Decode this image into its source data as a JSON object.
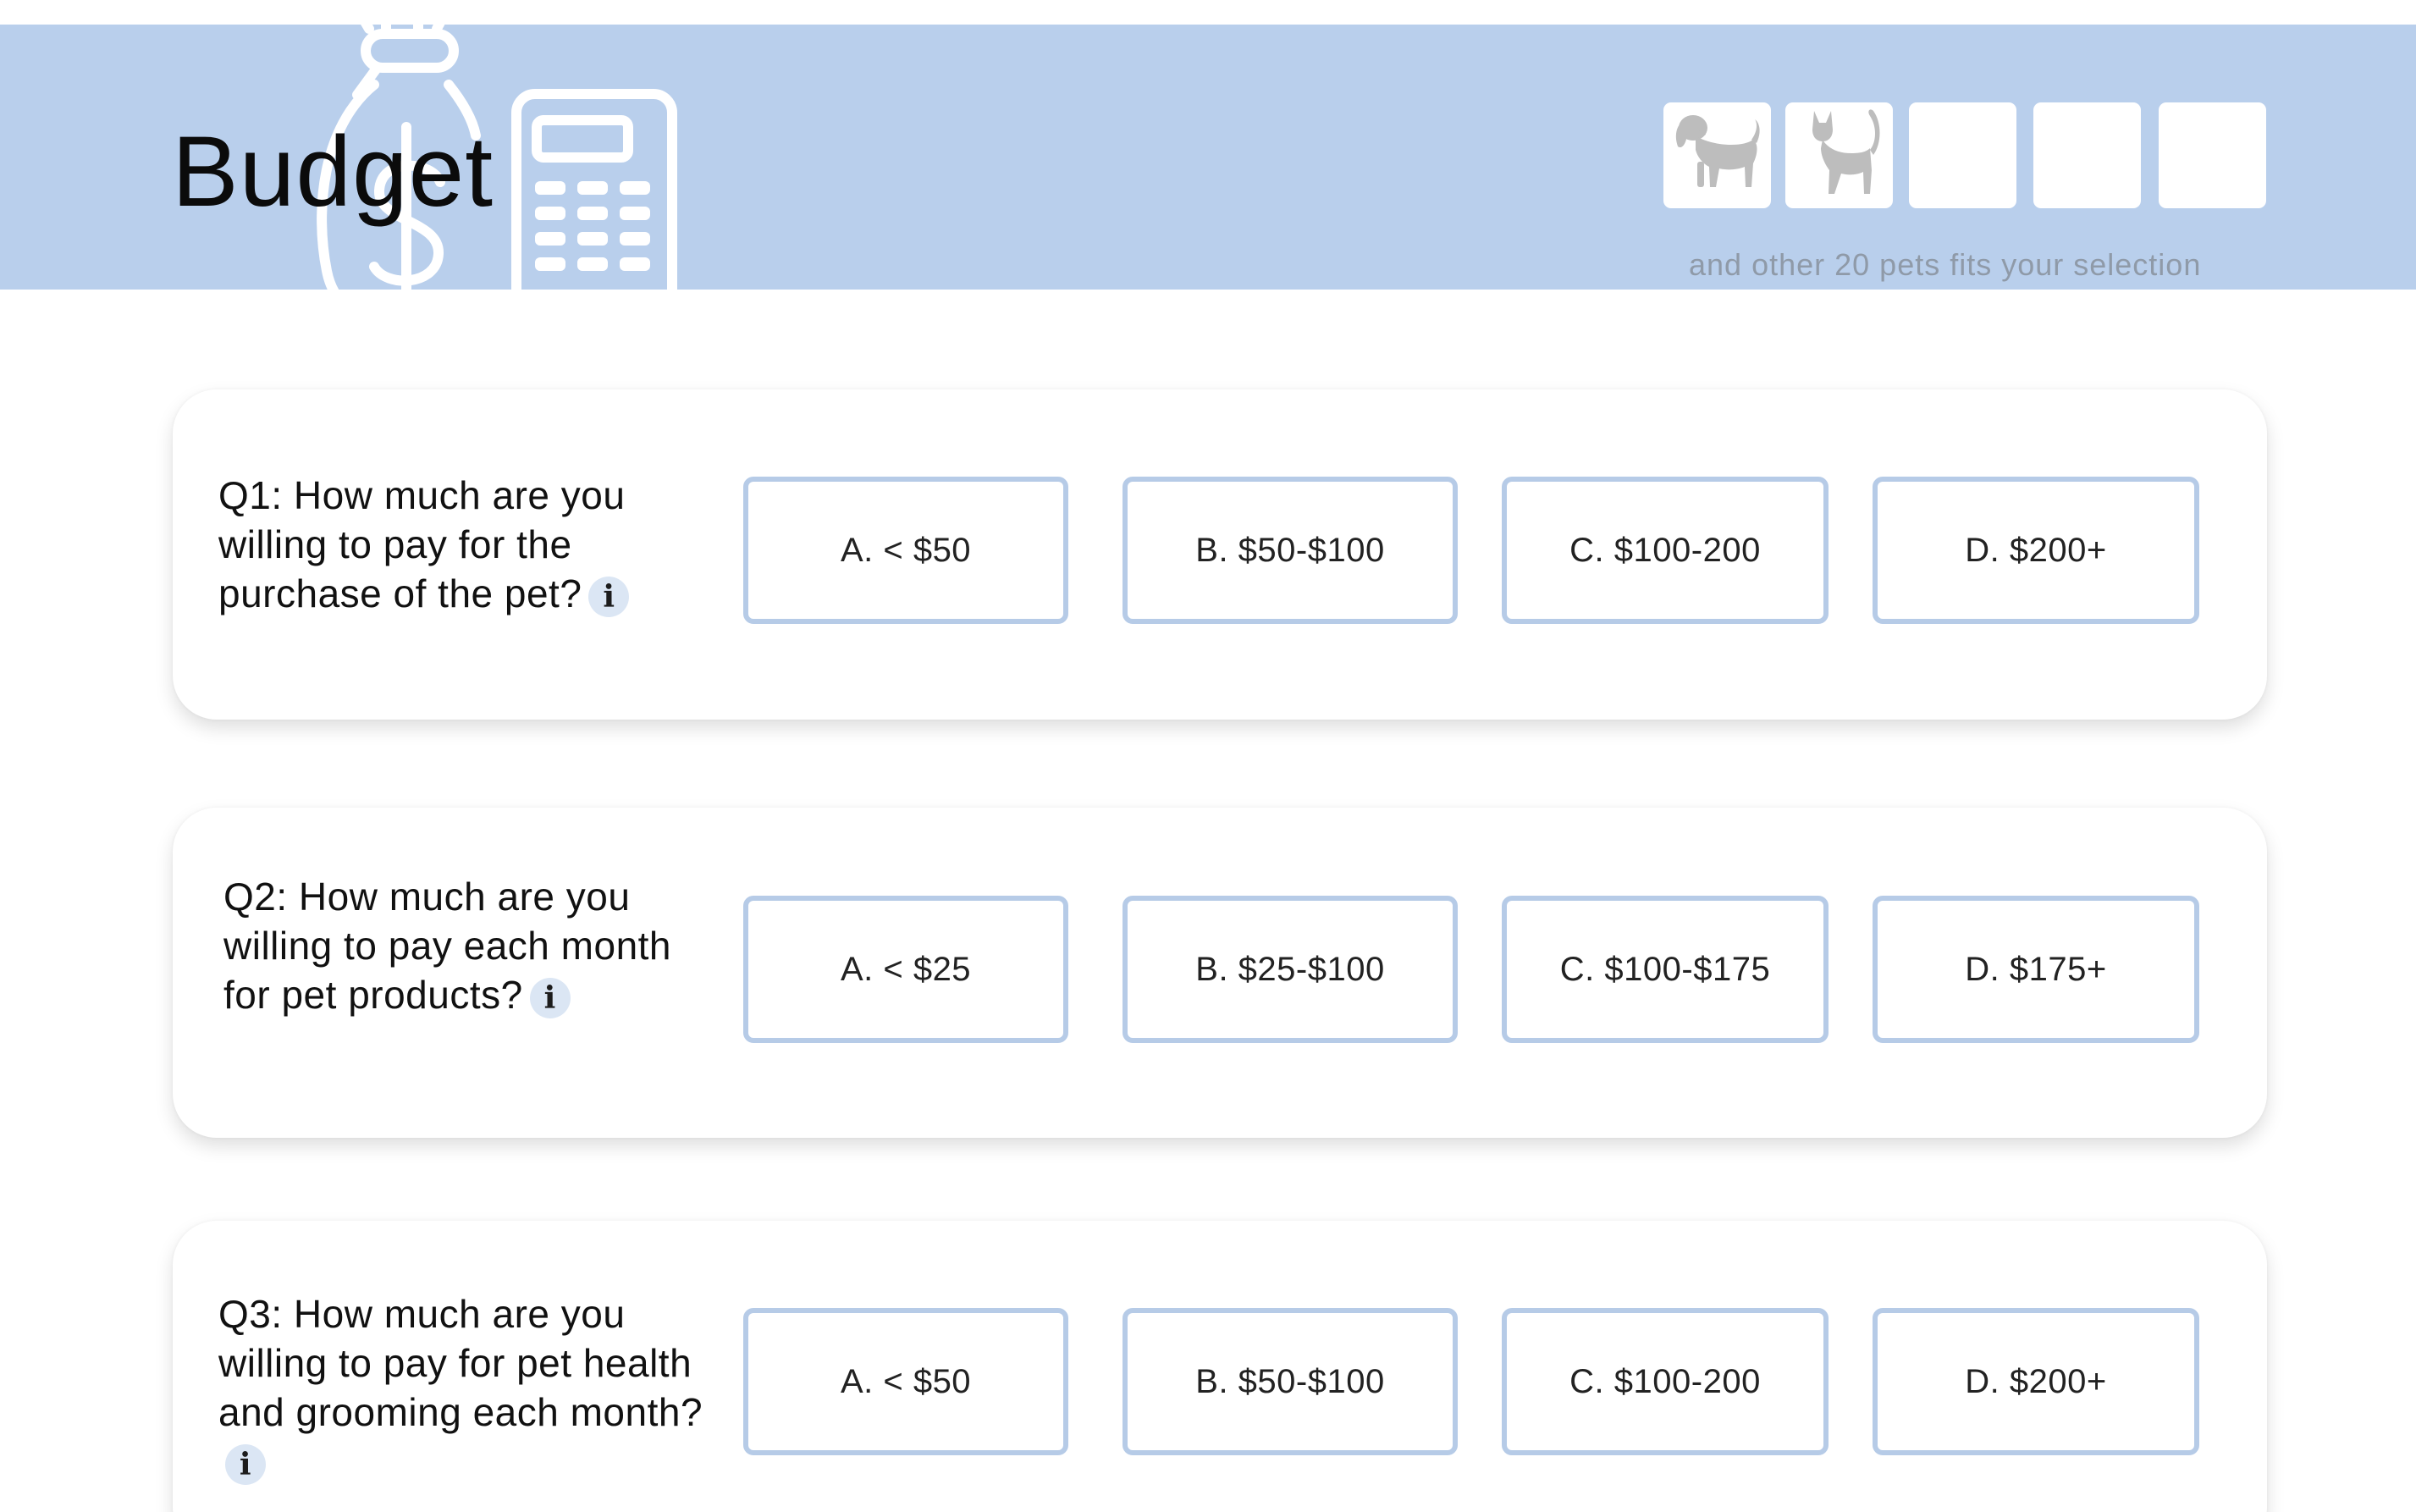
{
  "header": {
    "title": "Budget",
    "selection_note": "and other 20 pets fits your selection",
    "band_color": "#b9cfec",
    "pet_tiles": [
      {
        "icon": "dog-icon",
        "filled": true
      },
      {
        "icon": "cat-icon",
        "filled": true
      },
      {
        "icon": "empty-tile",
        "filled": false
      },
      {
        "icon": "empty-tile",
        "filled": false
      },
      {
        "icon": "empty-tile",
        "filled": false
      }
    ],
    "illustration_icons": [
      "money-bag-icon",
      "calculator-icon"
    ]
  },
  "questions": [
    {
      "text": "Q1: How much are you willing to pay for the purchase of the pet?",
      "info_icon": "i",
      "options": [
        "A. < $50",
        "B. $50-$100",
        "C. $100-200",
        "D. $200+"
      ]
    },
    {
      "text": "Q2: How much are you willing to pay each month for pet products?",
      "info_icon": "i",
      "options": [
        "A. < $25",
        "B. $25-$100",
        "C. $100-$175",
        "D. $175+"
      ]
    },
    {
      "text": "Q3: How much are you willing to pay for pet health and grooming each month?",
      "info_icon": "i",
      "options": [
        "A. < $50",
        "B. $50-$100",
        "C. $100-200",
        "D. $200+"
      ]
    }
  ],
  "colors": {
    "accent": "#b9cfec",
    "option_border": "#b6cbe7",
    "info_icon_bg": "#dbe6f4",
    "pet_silhouette": "#bdbdbd",
    "note_text": "#8f9aa8"
  }
}
